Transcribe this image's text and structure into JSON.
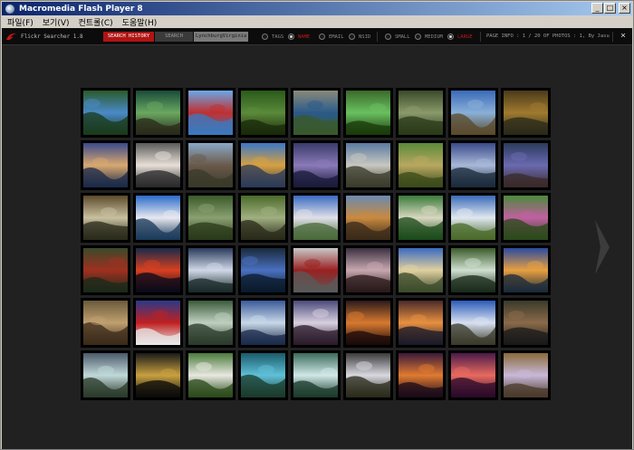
{
  "window": {
    "title": "Macromedia Flash Player 8",
    "controls": [
      "_",
      "□",
      "×"
    ]
  },
  "menubar": {
    "items": [
      "파일(F)",
      "보기(V)",
      "컨트롤(C)",
      "도움말(H)"
    ]
  },
  "toolbar": {
    "app_name": "Flickr Searcher 1.8",
    "search_history_label": "SEARCH HISTORY",
    "search_label": "SEARCH",
    "search_value": "LynchburgVirginia",
    "search_mode": [
      {
        "label": "TAGS",
        "selected": false
      },
      {
        "label": "NAME",
        "selected": true
      },
      {
        "label": "EMAIL",
        "selected": false
      },
      {
        "label": "NSID",
        "selected": false
      }
    ],
    "size_mode": [
      {
        "label": "SMALL",
        "selected": false
      },
      {
        "label": "MEDIUM",
        "selected": false
      },
      {
        "label": "LARGE",
        "selected": true
      }
    ],
    "page_info": "PAGE INFO : 1 / 20 OF PHOTOS : 1, By Jasu",
    "close_glyph": "×"
  },
  "colors": {
    "stage": "#212121",
    "toolbar": "#0c0c0c",
    "accent_red": "#b01414",
    "titlebar": "#0a246a"
  },
  "photos": [
    [
      "#2a5a2a",
      "#4a8ac8",
      "#1a3a1a"
    ],
    [
      "#1a4a3a",
      "#6aa860",
      "#2a2a1a"
    ],
    [
      "#6aa8e8",
      "#c03030",
      "#3a7ac0"
    ],
    [
      "#2a5a1a",
      "#5a8a3a",
      "#1a2a0a"
    ],
    [
      "#8a8a7a",
      "#2a5a8a",
      "#3a5a2a"
    ],
    [
      "#3a6a2a",
      "#6ac060",
      "#1a3a0a"
    ],
    [
      "#3a4a2a",
      "#8a9a6a",
      "#2a3a1a"
    ],
    [
      "#3a6ab8",
      "#8ab0d8",
      "#5a4a2a"
    ],
    [
      "#4a3a1a",
      "#a07a30",
      "#2a2a1a"
    ],
    [
      "#3a4a8a",
      "#d8a870",
      "#1a2a4a"
    ],
    [
      "#5a5a5a",
      "#e8e0d8",
      "#2a2a2a"
    ],
    [
      "#8aa8c8",
      "#6a5a4a",
      "#3a3a2a"
    ],
    [
      "#3a78c8",
      "#d8a040",
      "#2a3a5a"
    ],
    [
      "#3a3a6a",
      "#8a7ab8",
      "#1a1a3a"
    ],
    [
      "#5a7aa0",
      "#c8c8c0",
      "#3a3a2a"
    ],
    [
      "#5a8a3a",
      "#b8a860",
      "#3a4a1a"
    ],
    [
      "#3a4a8a",
      "#a8b8d8",
      "#1a2a3a"
    ],
    [
      "#2a3a5a",
      "#6a6ab0",
      "#3a2a2a"
    ],
    [
      "#5a4a2a",
      "#c8c0a0",
      "#2a2a1a"
    ],
    [
      "#2a6ac8",
      "#e8e8f0",
      "#1a3a5a"
    ],
    [
      "#3a5a2a",
      "#8aa070",
      "#2a3a1a"
    ],
    [
      "#4a6a2a",
      "#a0b080",
      "#2a2a1a"
    ],
    [
      "#3a6ac0",
      "#e0e0e8",
      "#4a6a3a"
    ],
    [
      "#6a8ab0",
      "#c88a40",
      "#3a2a1a"
    ],
    [
      "#3a7a3a",
      "#d8d8c0",
      "#1a4a1a"
    ],
    [
      "#3a6ab8",
      "#e0e8f0",
      "#4a6a2a"
    ],
    [
      "#4a8a3a",
      "#c060a0",
      "#2a4a1a"
    ],
    [
      "#3a4a2a",
      "#a03020",
      "#1a2a1a"
    ],
    [
      "#1a2a4a",
      "#d84020",
      "#0a0a1a"
    ],
    [
      "#2a3a5a",
      "#d0d8e8",
      "#1a2a2a"
    ],
    [
      "#1a2a3a",
      "#4a70c0",
      "#0a1a2a"
    ],
    [
      "#c8c8c8",
      "#9a2020",
      "#5a5a5a"
    ],
    [
      "#3a3040",
      "#c8a8b0",
      "#2a1a1a"
    ],
    [
      "#3a6ac0",
      "#e0d0a0",
      "#3a4a2a"
    ],
    [
      "#3a5a2a",
      "#d0e0d0",
      "#1a2a1a"
    ],
    [
      "#2a4aa0",
      "#e8a040",
      "#1a2a3a"
    ],
    [
      "#6a5a3a",
      "#c0a070",
      "#3a2a1a"
    ],
    [
      "#2a3a8a",
      "#c02020",
      "#e8e8e8"
    ],
    [
      "#3a5a3a",
      "#c0d0c0",
      "#2a3a2a"
    ],
    [
      "#3a5a9a",
      "#c8d8e8",
      "#1a2a4a"
    ],
    [
      "#4a4a7a",
      "#d8d0e0",
      "#2a1a2a"
    ],
    [
      "#2a1a1a",
      "#d87a30",
      "#1a0a0a"
    ],
    [
      "#4a2a2a",
      "#e89040",
      "#1a1a2a"
    ],
    [
      "#2a5ab8",
      "#d8e0f0",
      "#3a3a2a"
    ],
    [
      "#3a3a2a",
      "#8a6a4a",
      "#1a1a1a"
    ],
    [
      "#4a5a6a",
      "#c0d8d8",
      "#2a3a2a"
    ],
    [
      "#1a1a1a",
      "#c8a040",
      "#0a0a0a"
    ],
    [
      "#4a7a3a",
      "#e8e8e0",
      "#2a4a1a"
    ],
    [
      "#1a5a6a",
      "#60c0d8",
      "#1a3a2a"
    ],
    [
      "#3a6a5a",
      "#d0e8e8",
      "#1a3a2a"
    ],
    [
      "#3a3a3a",
      "#d8d8e0",
      "#2a2a1a"
    ],
    [
      "#3a1a3a",
      "#e07a30",
      "#1a0a1a"
    ],
    [
      "#4a1a4a",
      "#e86a60",
      "#2a0a2a"
    ],
    [
      "#8a6a3a",
      "#c8b8d8",
      "#4a3a2a"
    ]
  ]
}
